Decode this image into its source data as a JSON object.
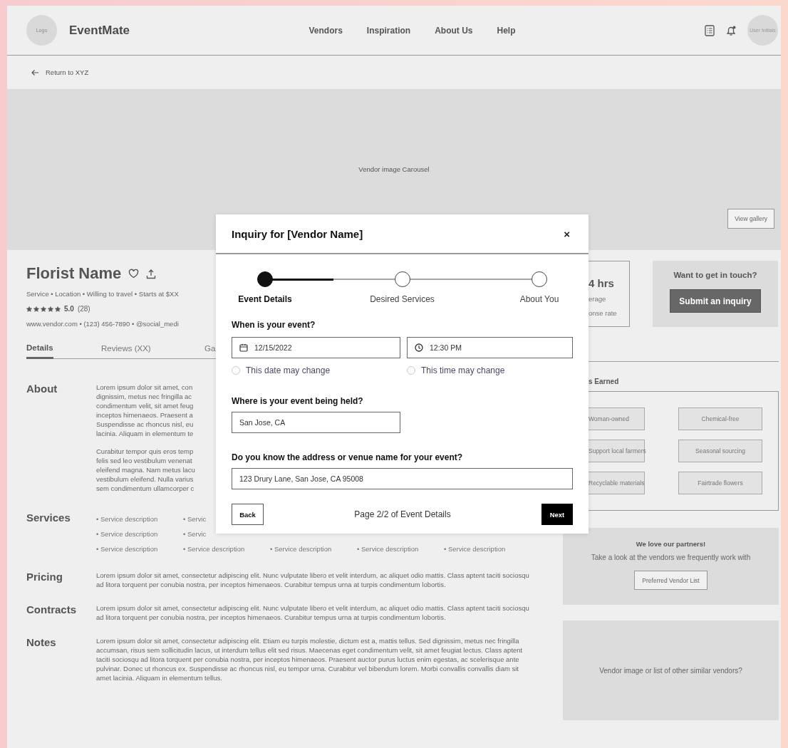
{
  "nav": {
    "logo": "Logo",
    "brand": "EventMate",
    "links": [
      "Vendors",
      "Inspiration",
      "About Us",
      "Help"
    ],
    "avatar": "User Initials"
  },
  "back_link": "Return to XYZ",
  "carousel": {
    "label": "Vendor image Carousel",
    "button": "View gallery"
  },
  "vendor": {
    "name": "Florist Name",
    "meta": "Service • Location • Willing to travel • Starts at $XX",
    "stars": 5,
    "rating": "5.0",
    "review_count": "(28)",
    "contact": "www.vendor.com • (123) 456-7890 • @social_medi"
  },
  "tabs": [
    {
      "label": "Details",
      "selected": true
    },
    {
      "label": "Reviews (XX)",
      "selected": false
    },
    {
      "label": "Ga",
      "selected": false
    }
  ],
  "sections": [
    {
      "kind": "lines",
      "title": "About",
      "paragraphs": [
        [
          "Lorem ipsum dolor sit amet, con",
          "dignissim, metus nec fringilla ac",
          "condimentum velit, sit amet feug",
          "inceptos himenaeos. Praesent a",
          "Suspendisse ac rhoncus nisl, eu",
          "lacinia. Aliquam in elementum te"
        ],
        [
          "Curabitur tempor quis eros temp",
          "felis sed leo vestibulum venenat",
          "eleifend magna. Nam metus lacu",
          "vestibulum eleifend. Nulla varius",
          "sem condimentum ullamcorper c"
        ]
      ]
    },
    {
      "kind": "list",
      "title": "Services",
      "rows": [
        [
          "• Service description",
          "• Servic"
        ],
        [
          "• Service description",
          "• Servic"
        ],
        [
          "• Service description",
          "• Service description",
          "• Service description",
          "• Service description",
          "• Service description"
        ]
      ]
    },
    {
      "kind": "text",
      "title": "Pricing",
      "text": "Lorem ipsum dolor sit amet, consectetur adipiscing elit. Nunc vulputate libero et velit interdum, ac aliquet odio mattis. Class aptent taciti sociosqu ad litora torquent per conubia nostra, per inceptos himenaeos. Curabitur tempus urna at turpis condimentum lobortis."
    },
    {
      "kind": "text",
      "title": "Contracts",
      "text": "Lorem ipsum dolor sit amet, consectetur adipiscing elit. Nunc vulputate libero et velit interdum, ac aliquet odio mattis. Class aptent taciti sociosqu ad litora torquent per conubia nostra, per inceptos himenaeos. Curabitur tempus urna at turpis condimentum lobortis."
    },
    {
      "kind": "text",
      "title": "Notes",
      "text": "Lorem ipsum dolor sit amet, consectetur adipiscing elit. Etiam eu turpis molestie, dictum est a, mattis tellus. Sed dignissim, metus nec fringilla accumsan, risus sem sollicitudin lacus, ut interdum tellus elit sed risus. Maecenas eget condimentum velit, sit amet feugiat lectus. Class aptent taciti sociosqu ad litora torquent per conubia nostra, per inceptos himenaeos. Praesent auctor purus luctus enim egestas, ac scelerisque ante pulvinar. Donec ut rhoncus ex. Suspendisse ac rhoncus nisl, eu tempor urna. Curabitur vel bibendum lorem. Morbi convallis convallis diam sit amet lacinia. Aliquam in elementum tellus."
    }
  ],
  "response": {
    "value": "4 hrs",
    "lines": [
      "erage",
      "onse rate"
    ]
  },
  "contact_card": {
    "title": "Want to get in touch?",
    "button": "Submit an inquiry"
  },
  "badges": {
    "title": "s Earned",
    "items": [
      "Woman-owned",
      "Chemical-free",
      "Support local farmers",
      "Seasonal sourcing",
      "Recyclable materials",
      "Fairtrade flowers"
    ]
  },
  "partners": {
    "title": "We love our partners!",
    "text": "Take a look at the vendors we frequently work with",
    "button": "Preferred Vendor List"
  },
  "similar": {
    "text": "Vendor image or list of other similar vendors?"
  },
  "modal": {
    "title": "Inquiry for [Vendor Name]",
    "close": "×",
    "stepper": {
      "level": 0.25,
      "steps": [
        {
          "label": "Event Details",
          "selected": true
        },
        {
          "label": "Desired Services",
          "selected": false
        },
        {
          "label": "About You",
          "selected": false
        }
      ]
    },
    "date_question": "When is your event?",
    "date": {
      "value": "12/15/2022"
    },
    "time": {
      "value": "12:30 PM"
    },
    "flex_options": [
      {
        "label": "This date may change",
        "checked": false
      },
      {
        "label": "This time may change",
        "checked": false
      }
    ],
    "location_question": "Where is your event being held?",
    "location": {
      "value": "San Jose, CA"
    },
    "venue_question": "Do you know the address or venue name for your event?",
    "venue": {
      "value": "123 Drury Lane, San Jose, CA 95008"
    },
    "back": "Back",
    "page_info": "Page 2/2 of Event Details",
    "next": "Next"
  }
}
